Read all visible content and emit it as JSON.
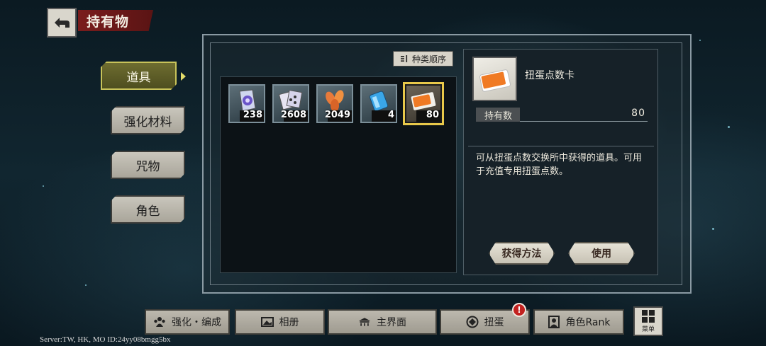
{
  "header": {
    "title": "持有物"
  },
  "tabs": [
    {
      "label": "道具",
      "active": true
    },
    {
      "label": "强化材料",
      "active": false
    },
    {
      "label": "咒物",
      "active": false
    },
    {
      "label": "角色",
      "active": false
    }
  ],
  "sort": {
    "label": "种类顺序"
  },
  "items": [
    {
      "icon": "dice-pouch-icon",
      "count": "238"
    },
    {
      "icon": "dice-cards-icon",
      "count": "2608"
    },
    {
      "icon": "leaf-icon",
      "count": "2049"
    },
    {
      "icon": "blue-crystal-icon",
      "count": "4"
    },
    {
      "icon": "gacha-card-icon",
      "count": "80",
      "selected": true
    }
  ],
  "detail": {
    "name": "扭蛋点数卡",
    "held_label": "持有数",
    "held_value": "80",
    "description": "可从扭蛋点数交换所中获得的道具。可用于充值专用扭蛋点数。",
    "obtain_label": "获得方法",
    "use_label": "使用"
  },
  "bottom_nav": [
    {
      "label": "强化・编成",
      "icon": "party-icon"
    },
    {
      "label": "相册",
      "icon": "album-icon"
    },
    {
      "label": "主界面",
      "icon": "home-icon"
    },
    {
      "label": "扭蛋",
      "icon": "gacha-icon"
    },
    {
      "label": "角色Rank",
      "icon": "character-icon"
    }
  ],
  "alert": {
    "text": "!"
  },
  "menu": {
    "label": "菜单"
  },
  "server_info": "Server:TW, HK, MO ID:24yy08bmgg5bx",
  "colors": {
    "accent_gold": "#e8c84a",
    "title_red": "#7a1d1d",
    "alert_red": "#c2211f"
  }
}
